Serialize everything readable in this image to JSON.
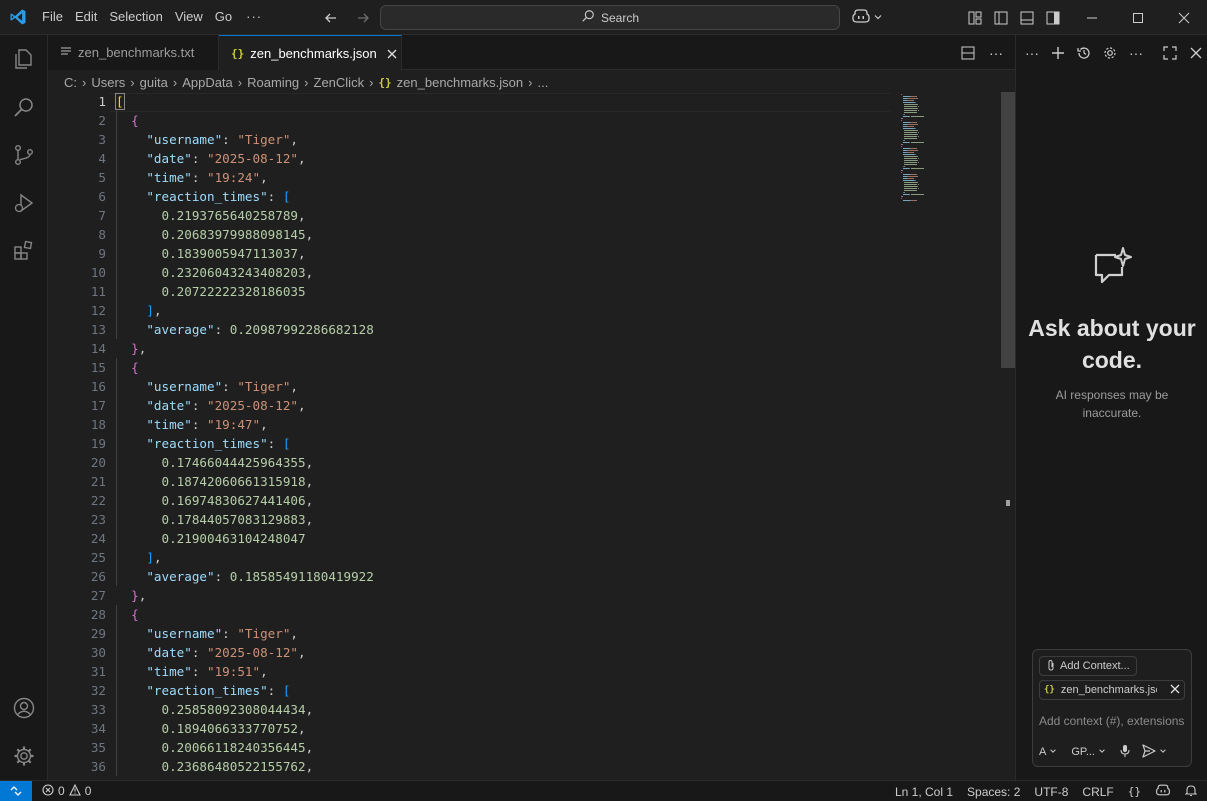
{
  "menu": {
    "items": [
      "File",
      "Edit",
      "Selection",
      "View",
      "Go"
    ],
    "more": "···"
  },
  "search": {
    "label": "Search"
  },
  "tabs": [
    {
      "label": "zen_benchmarks.txt",
      "active": false
    },
    {
      "label": "zen_benchmarks.json",
      "active": true
    }
  ],
  "json_icon": "{}",
  "breadcrumb": {
    "items": [
      "C:",
      "Users",
      "guita",
      "AppData",
      "Roaming",
      "ZenClick"
    ],
    "file": "zen_benchmarks.json",
    "tail": "..."
  },
  "editor": {
    "current_line": 1,
    "lines": [
      [
        [
          "p1",
          "["
        ]
      ],
      [
        [
          "sp",
          "  "
        ],
        [
          "p2",
          "{"
        ]
      ],
      [
        [
          "sp",
          "    "
        ],
        [
          "key",
          "\"username\""
        ],
        [
          "pun",
          ": "
        ],
        [
          "str",
          "\"Tiger\""
        ],
        [
          "pun",
          ","
        ]
      ],
      [
        [
          "sp",
          "    "
        ],
        [
          "key",
          "\"date\""
        ],
        [
          "pun",
          ": "
        ],
        [
          "str",
          "\"2025-08-12\""
        ],
        [
          "pun",
          ","
        ]
      ],
      [
        [
          "sp",
          "    "
        ],
        [
          "key",
          "\"time\""
        ],
        [
          "pun",
          ": "
        ],
        [
          "str",
          "\"19:24\""
        ],
        [
          "pun",
          ","
        ]
      ],
      [
        [
          "sp",
          "    "
        ],
        [
          "key",
          "\"reaction_times\""
        ],
        [
          "pun",
          ": "
        ],
        [
          "p3",
          "["
        ]
      ],
      [
        [
          "sp",
          "      "
        ],
        [
          "num",
          "0.2193765640258789"
        ],
        [
          "pun",
          ","
        ]
      ],
      [
        [
          "sp",
          "      "
        ],
        [
          "num",
          "0.20683979988098145"
        ],
        [
          "pun",
          ","
        ]
      ],
      [
        [
          "sp",
          "      "
        ],
        [
          "num",
          "0.1839005947113037"
        ],
        [
          "pun",
          ","
        ]
      ],
      [
        [
          "sp",
          "      "
        ],
        [
          "num",
          "0.23206043243408203"
        ],
        [
          "pun",
          ","
        ]
      ],
      [
        [
          "sp",
          "      "
        ],
        [
          "num",
          "0.20722222328186035"
        ]
      ],
      [
        [
          "sp",
          "    "
        ],
        [
          "p3",
          "]"
        ],
        [
          "pun",
          ","
        ]
      ],
      [
        [
          "sp",
          "    "
        ],
        [
          "key",
          "\"average\""
        ],
        [
          "pun",
          ": "
        ],
        [
          "num",
          "0.20987992286682128"
        ]
      ],
      [
        [
          "sp",
          "  "
        ],
        [
          "p2",
          "}"
        ],
        [
          "pun",
          ","
        ]
      ],
      [
        [
          "sp",
          "  "
        ],
        [
          "p2",
          "{"
        ]
      ],
      [
        [
          "sp",
          "    "
        ],
        [
          "key",
          "\"username\""
        ],
        [
          "pun",
          ": "
        ],
        [
          "str",
          "\"Tiger\""
        ],
        [
          "pun",
          ","
        ]
      ],
      [
        [
          "sp",
          "    "
        ],
        [
          "key",
          "\"date\""
        ],
        [
          "pun",
          ": "
        ],
        [
          "str",
          "\"2025-08-12\""
        ],
        [
          "pun",
          ","
        ]
      ],
      [
        [
          "sp",
          "    "
        ],
        [
          "key",
          "\"time\""
        ],
        [
          "pun",
          ": "
        ],
        [
          "str",
          "\"19:47\""
        ],
        [
          "pun",
          ","
        ]
      ],
      [
        [
          "sp",
          "    "
        ],
        [
          "key",
          "\"reaction_times\""
        ],
        [
          "pun",
          ": "
        ],
        [
          "p3",
          "["
        ]
      ],
      [
        [
          "sp",
          "      "
        ],
        [
          "num",
          "0.17466044425964355"
        ],
        [
          "pun",
          ","
        ]
      ],
      [
        [
          "sp",
          "      "
        ],
        [
          "num",
          "0.18742060661315918"
        ],
        [
          "pun",
          ","
        ]
      ],
      [
        [
          "sp",
          "      "
        ],
        [
          "num",
          "0.16974830627441406"
        ],
        [
          "pun",
          ","
        ]
      ],
      [
        [
          "sp",
          "      "
        ],
        [
          "num",
          "0.17844057083129883"
        ],
        [
          "pun",
          ","
        ]
      ],
      [
        [
          "sp",
          "      "
        ],
        [
          "num",
          "0.21900463104248047"
        ]
      ],
      [
        [
          "sp",
          "    "
        ],
        [
          "p3",
          "]"
        ],
        [
          "pun",
          ","
        ]
      ],
      [
        [
          "sp",
          "    "
        ],
        [
          "key",
          "\"average\""
        ],
        [
          "pun",
          ": "
        ],
        [
          "num",
          "0.18585491180419922"
        ]
      ],
      [
        [
          "sp",
          "  "
        ],
        [
          "p2",
          "}"
        ],
        [
          "pun",
          ","
        ]
      ],
      [
        [
          "sp",
          "  "
        ],
        [
          "p2",
          "{"
        ]
      ],
      [
        [
          "sp",
          "    "
        ],
        [
          "key",
          "\"username\""
        ],
        [
          "pun",
          ": "
        ],
        [
          "str",
          "\"Tiger\""
        ],
        [
          "pun",
          ","
        ]
      ],
      [
        [
          "sp",
          "    "
        ],
        [
          "key",
          "\"date\""
        ],
        [
          "pun",
          ": "
        ],
        [
          "str",
          "\"2025-08-12\""
        ],
        [
          "pun",
          ","
        ]
      ],
      [
        [
          "sp",
          "    "
        ],
        [
          "key",
          "\"time\""
        ],
        [
          "pun",
          ": "
        ],
        [
          "str",
          "\"19:51\""
        ],
        [
          "pun",
          ","
        ]
      ],
      [
        [
          "sp",
          "    "
        ],
        [
          "key",
          "\"reaction_times\""
        ],
        [
          "pun",
          ": "
        ],
        [
          "p3",
          "["
        ]
      ],
      [
        [
          "sp",
          "      "
        ],
        [
          "num",
          "0.25858092308044434"
        ],
        [
          "pun",
          ","
        ]
      ],
      [
        [
          "sp",
          "      "
        ],
        [
          "num",
          "0.1894066333770752"
        ],
        [
          "pun",
          ","
        ]
      ],
      [
        [
          "sp",
          "      "
        ],
        [
          "num",
          "0.20066118240356445"
        ],
        [
          "pun",
          ","
        ]
      ],
      [
        [
          "sp",
          "      "
        ],
        [
          "num",
          "0.23686480522155762"
        ],
        [
          "pun",
          ","
        ]
      ]
    ]
  },
  "chat": {
    "title": "Ask about your code.",
    "subtitle": "AI responses may be inaccurate.",
    "add_context": "Add Context...",
    "context_file": "zen_benchmarks.json",
    "input_placeholder": "Add context (#), extensions (@), commands (/)",
    "mode": "A",
    "model": "GP..."
  },
  "status": {
    "errors": "0",
    "warnings": "0",
    "position": "Ln 1, Col 1",
    "spaces": "Spaces: 2",
    "encoding": "UTF-8",
    "eol": "CRLF",
    "language_icon": "{}"
  },
  "colors": {
    "accent": "#0078d4",
    "bracket1": "#ffd700",
    "bracket2": "#da70d6",
    "bracket3": "#179fff",
    "key": "#9cdcfe",
    "string": "#ce9178",
    "number": "#b5cea8"
  }
}
